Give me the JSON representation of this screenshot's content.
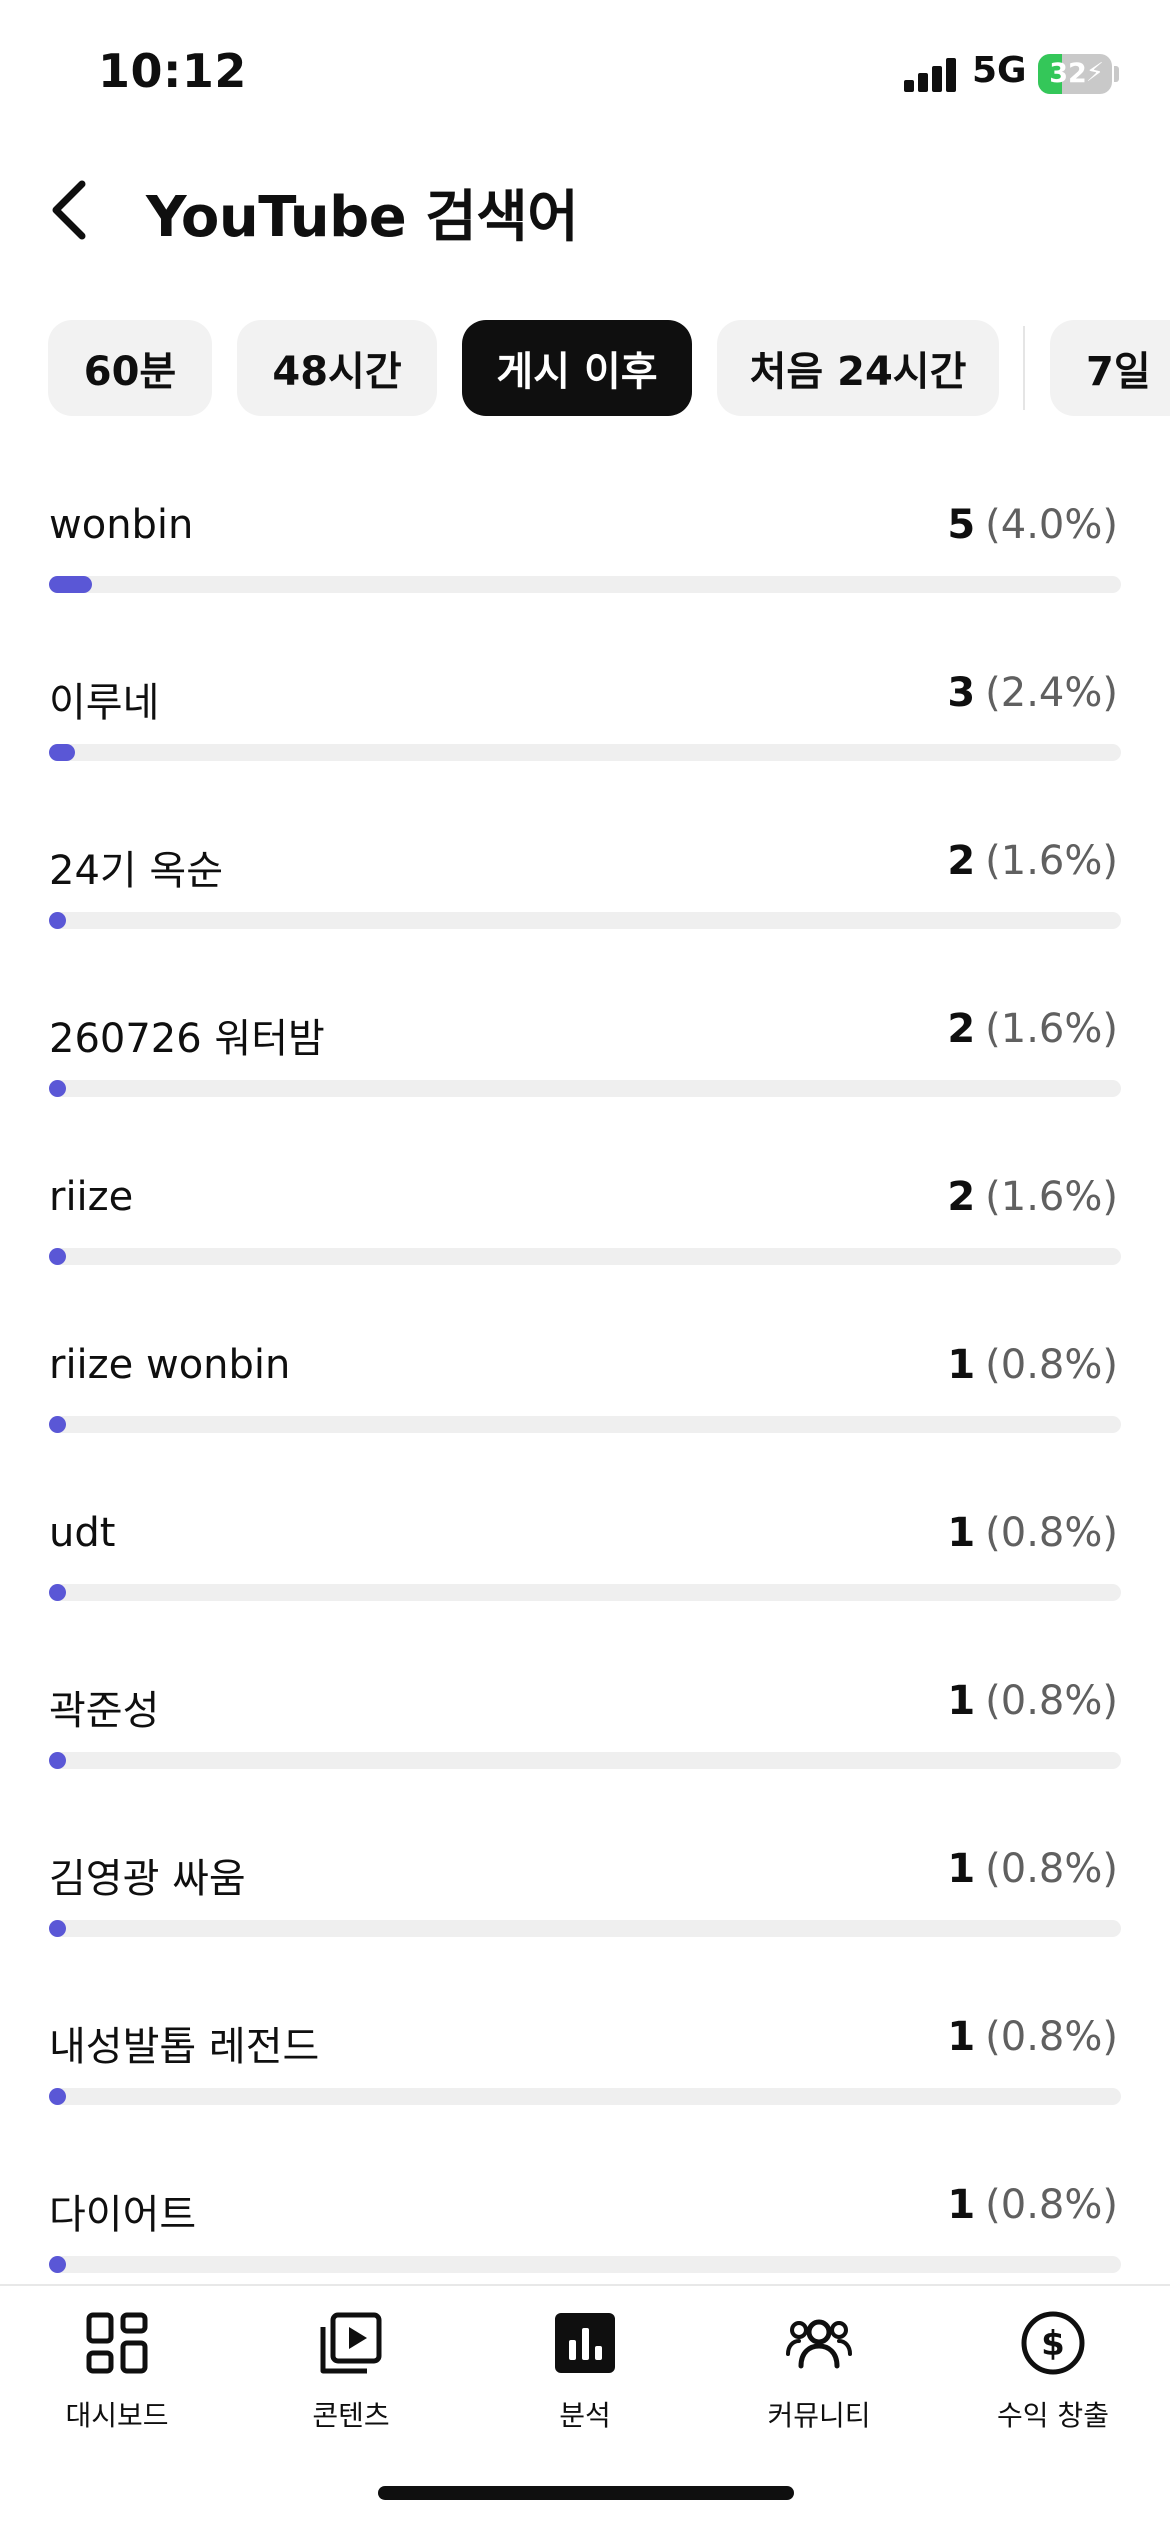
{
  "status_bar": {
    "time": "10:12",
    "network": "5G",
    "battery": "32",
    "battery_level": 0.32
  },
  "header": {
    "title": "YouTube 검색어",
    "back_icon": "chevron-left-icon"
  },
  "filters": [
    {
      "label": "60분",
      "active": false
    },
    {
      "label": "48시간",
      "active": false
    },
    {
      "label": "게시 이후",
      "active": true
    },
    {
      "label": "처음 24시간",
      "active": false
    },
    {
      "label": "7일",
      "active": false
    }
  ],
  "terms": [
    {
      "label": "wonbin",
      "count": "5",
      "percent": "(4.0%)",
      "share": 0.04
    },
    {
      "label": "이루네",
      "count": "3",
      "percent": "(2.4%)",
      "share": 0.024
    },
    {
      "label": "24기 옥순",
      "count": "2",
      "percent": "(1.6%)",
      "share": 0.016
    },
    {
      "label": "260726 워터밤",
      "count": "2",
      "percent": "(1.6%)",
      "share": 0.016
    },
    {
      "label": "riize",
      "count": "2",
      "percent": "(1.6%)",
      "share": 0.016
    },
    {
      "label": "riize wonbin",
      "count": "1",
      "percent": "(0.8%)",
      "share": 0.008
    },
    {
      "label": "udt",
      "count": "1",
      "percent": "(0.8%)",
      "share": 0.008
    },
    {
      "label": "곽준성",
      "count": "1",
      "percent": "(0.8%)",
      "share": 0.008
    },
    {
      "label": "김영광 싸움",
      "count": "1",
      "percent": "(0.8%)",
      "share": 0.008
    },
    {
      "label": "내성발톱 레전드",
      "count": "1",
      "percent": "(0.8%)",
      "share": 0.008
    },
    {
      "label": "다이어트",
      "count": "1",
      "percent": "(0.8%)",
      "share": 0.008
    }
  ],
  "bottom_nav": [
    {
      "label": "대시보드",
      "icon": "dashboard-icon",
      "active": false
    },
    {
      "label": "콘텐츠",
      "icon": "content-icon",
      "active": false
    },
    {
      "label": "분석",
      "icon": "analytics-icon",
      "active": true
    },
    {
      "label": "커뮤니티",
      "icon": "community-icon",
      "active": false
    },
    {
      "label": "수익 창출",
      "icon": "monetization-icon",
      "active": false
    }
  ],
  "colors": {
    "accent": "#5a57d6",
    "track": "#efefef",
    "chip": "#f2f2f2",
    "chip_active": "#0f0f0f",
    "battery": "#34c759"
  }
}
